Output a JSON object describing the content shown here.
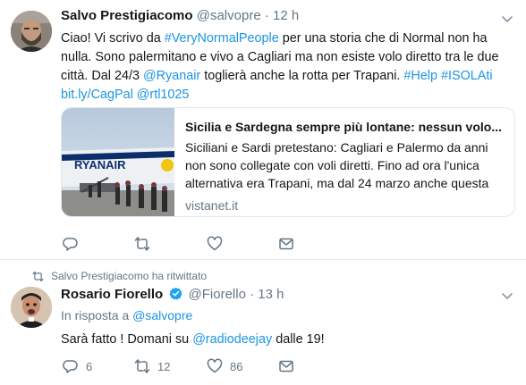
{
  "tweet1": {
    "author_name": "Salvo Prestigiacomo",
    "author_handle": "@salvopre",
    "dot": "·",
    "time": "12 h",
    "text_parts": [
      {
        "t": "Ciao! Vi scrivo da ",
        "link": false
      },
      {
        "t": "#VeryNormalPeople",
        "link": true
      },
      {
        "t": " per una storia che di Normal non ha nulla. Sono palermitano e vivo a Cagliari ma non esiste volo diretto tra le due città. Dal 24/3 ",
        "link": false
      },
      {
        "t": "@Ryanair",
        "link": true
      },
      {
        "t": " toglierà anche la rotta per Trapani. ",
        "link": false
      },
      {
        "t": "#Help",
        "link": true
      },
      {
        "t": " ",
        "link": false
      },
      {
        "t": "#ISOLAti",
        "link": true
      },
      {
        "t": " ",
        "link": false
      },
      {
        "t": "bit.ly/CagPal",
        "link": true
      },
      {
        "t": " ",
        "link": false
      },
      {
        "t": "@rtl1025",
        "link": true
      }
    ],
    "card": {
      "title": "Sicilia e Sardegna sempre più lontane: nessun volo...",
      "description": "Siciliani e Sardi pretestano: Cagliari e Palermo da anni non sono collegate con voli diretti. Fino ad ora l'unica alternativa era Trapani, ma dal 24 marzo anche questa",
      "domain": "vistanet.it",
      "image_text": "RYANAIR"
    },
    "actions": {
      "reply_count": "",
      "retweet_count": "",
      "like_count": ""
    }
  },
  "retweeted_by": "Salvo Prestigiacomo ha ritwittato",
  "tweet2": {
    "author_name": "Rosario Fiorello",
    "author_handle": "@Fiorello",
    "dot": "·",
    "time": "13 h",
    "reply_to_prefix": "In risposta a",
    "reply_to_handle": "@salvopre",
    "text_parts": [
      {
        "t": "Sarà fatto ! Domani su ",
        "link": false
      },
      {
        "t": "@radiodeejay",
        "link": true
      },
      {
        "t": " dalle 19!",
        "link": false
      }
    ],
    "actions": {
      "reply_count": "6",
      "retweet_count": "12",
      "like_count": "86"
    }
  },
  "colors": {
    "link": "#1b95e0",
    "secondary": "#657786",
    "verified": "#1da1f2",
    "divider": "#e6ecf0"
  },
  "icons": [
    "reply-icon",
    "retweet-icon",
    "like-icon",
    "message-icon",
    "caret-down-icon",
    "verified-icon"
  ]
}
